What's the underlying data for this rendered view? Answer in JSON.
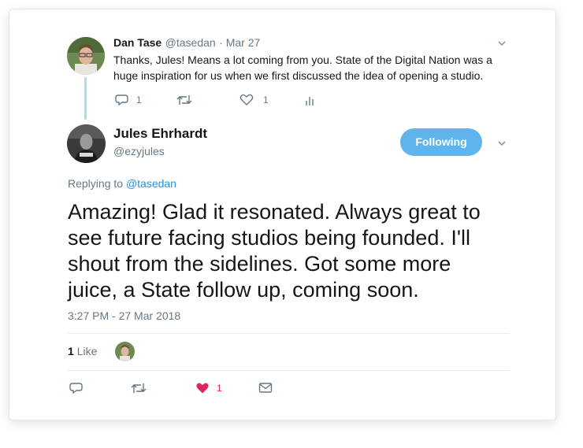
{
  "parent_tweet": {
    "author_name": "Dan Tase",
    "author_handle": "@tasedan",
    "date": "· Mar 27",
    "text_line1": "Thanks, Jules! Means a lot coming from you. State of the Digital Nation was a",
    "text_line2": "huge inspiration for us when we first discussed the idea of opening a studio.",
    "reply_count": "1",
    "like_count": "1",
    "icons": [
      "reply-icon",
      "retweet-icon",
      "heart-icon",
      "analytics-icon",
      "chevron-down-icon"
    ]
  },
  "main_tweet": {
    "author_name": "Jules Ehrhardt",
    "author_handle": "@ezyjules",
    "follow_label": "Following",
    "replying_prefix": "Replying to",
    "replying_to": "@tasedan",
    "text_line1": "Amazing! Glad it resonated. Always great to",
    "text_line2": "see future facing studios being founded. I'll",
    "text_line3": "shout from the sidelines. Got some more",
    "text_line4": "juice, a State follow up, coming soon.",
    "timestamp": "3:27 PM - 27 Mar 2018",
    "likes_count": "1",
    "likes_label": "Like",
    "action_like_count": "1",
    "colors": {
      "accent": "#1b95e0",
      "follow_button": "#5fb4eb",
      "liked_heart": "#e0245e"
    },
    "icons": [
      "reply-icon",
      "retweet-icon",
      "heart-filled-icon",
      "message-icon",
      "chevron-down-icon"
    ]
  }
}
